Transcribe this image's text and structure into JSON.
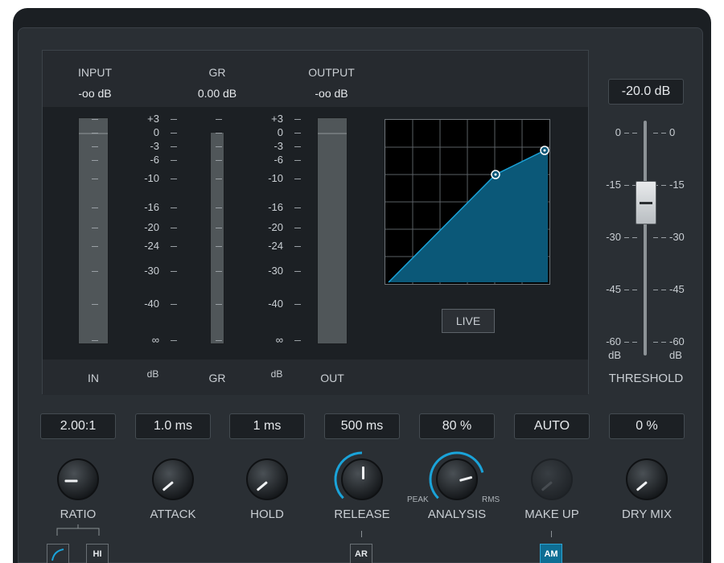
{
  "meters": {
    "input_label": "INPUT",
    "input_value": "-oo dB",
    "gr_label": "GR",
    "gr_value": "0.00 dB",
    "output_label": "OUTPUT",
    "output_value": "-oo dB",
    "scale": [
      "+3",
      "0",
      "-3",
      "-6",
      "-10",
      "-16",
      "-20",
      "-24",
      "-30",
      "-40",
      "∞"
    ],
    "bottom": {
      "in": "IN",
      "db_left": "dB",
      "gr": "GR",
      "db_right": "dB",
      "out": "OUT"
    }
  },
  "graph": {
    "live_label": "LIVE"
  },
  "threshold": {
    "value": "-20.0 dB",
    "label": "THRESHOLD",
    "scale": [
      "0",
      "-15",
      "-30",
      "-45",
      "-60"
    ],
    "unit": "dB",
    "level": -20
  },
  "controls": [
    {
      "id": "ratio",
      "value": "2.00:1",
      "label": "RATIO",
      "accent": false
    },
    {
      "id": "attack",
      "value": "1.0 ms",
      "label": "ATTACK",
      "accent": false
    },
    {
      "id": "hold",
      "value": "1 ms",
      "label": "HOLD",
      "accent": false
    },
    {
      "id": "release",
      "value": "500 ms",
      "label": "RELEASE",
      "accent": true
    },
    {
      "id": "analysis",
      "value": "80 %",
      "label": "ANALYSIS",
      "accent": true,
      "left": "PEAK",
      "right": "RMS"
    },
    {
      "id": "makeup",
      "value": "AUTO",
      "label": "MAKE UP",
      "accent": false,
      "disabled": true
    },
    {
      "id": "drymix",
      "value": "0 %",
      "label": "DRY MIX",
      "accent": false
    }
  ],
  "buttons": {
    "hi": "HI",
    "ar": "AR",
    "am": "AM"
  },
  "colors": {
    "accent": "#1aa3d9",
    "graph_fill": "#0b5878",
    "panel": "#2a2f34"
  }
}
